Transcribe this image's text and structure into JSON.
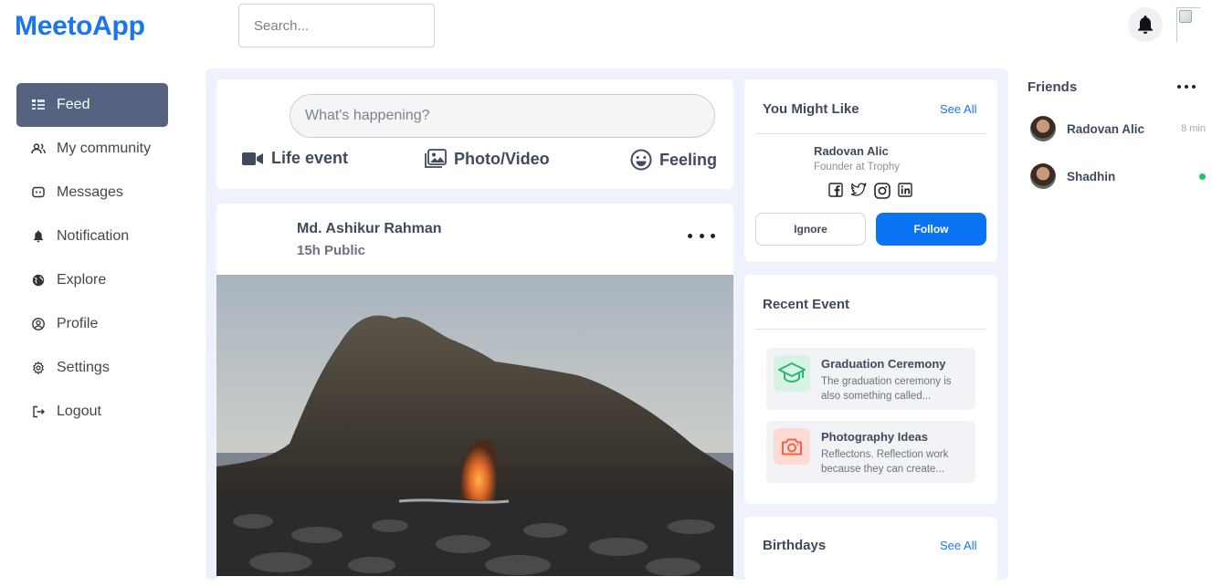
{
  "app": {
    "logo": "MeetoApp"
  },
  "header": {
    "search_placeholder": "Search..."
  },
  "sidebar": {
    "items": [
      {
        "label": "Feed",
        "icon": "feed-icon",
        "active": true
      },
      {
        "label": "My community",
        "icon": "community-icon",
        "active": false
      },
      {
        "label": "Messages",
        "icon": "messages-icon",
        "active": false
      },
      {
        "label": "Notification",
        "icon": "bell-icon",
        "active": false
      },
      {
        "label": "Explore",
        "icon": "globe-icon",
        "active": false
      },
      {
        "label": "Profile",
        "icon": "profile-icon",
        "active": false
      },
      {
        "label": "Settings",
        "icon": "gear-icon",
        "active": false
      },
      {
        "label": "Logout",
        "icon": "logout-icon",
        "active": false
      }
    ]
  },
  "composer": {
    "placeholder": "What's happening?",
    "actions": [
      "Life event",
      "Photo/Video",
      "Feeling"
    ]
  },
  "post": {
    "author": "Md. Ashikur Rahman",
    "meta": "15h Public"
  },
  "suggestions": {
    "title": "You Might Like",
    "see_all": "See All",
    "name": "Radovan Alic",
    "role": "Founder at Trophy",
    "ignore_label": "Ignore",
    "follow_label": "Follow"
  },
  "events": {
    "title": "Recent Event",
    "items": [
      {
        "title": "Graduation Ceremony",
        "desc": "The graduation ceremony is also something called...",
        "icon": "graduation-cap-icon",
        "color": "#2bb673"
      },
      {
        "title": "Photography Ideas",
        "desc": "Reflectons. Reflection work because they can create...",
        "icon": "camera-icon",
        "color": "#f2634a"
      }
    ]
  },
  "birthdays": {
    "title": "Birthdays",
    "see_all": "See All"
  },
  "friends": {
    "title": "Friends",
    "items": [
      {
        "name": "Radovan Alic",
        "status": "8 min"
      },
      {
        "name": "Shadhin",
        "status": "online"
      }
    ]
  },
  "colors": {
    "accent": "#1a75f0",
    "active_nav": "#566380",
    "panel_bg": "#edf2fb",
    "online": "#22c55e"
  }
}
